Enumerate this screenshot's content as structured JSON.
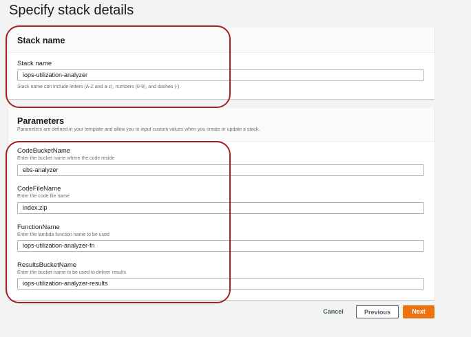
{
  "page_title": "Specify stack details",
  "stack": {
    "title": "Stack name",
    "label": "Stack name",
    "value": "iops-utilization-analyzer",
    "hint": "Stack name can include letters (A-Z and a-z), numbers (0-9), and dashes (-)."
  },
  "params": {
    "title": "Parameters",
    "description": "Parameters are defined in your template and allow you to input custom values when you create or update a stack.",
    "fields": [
      {
        "label": "CodeBucketName",
        "desc": "Enter the bucket name where the code reside",
        "value": "ebs-analyzer"
      },
      {
        "label": "CodeFileName",
        "desc": "Enter the code file name",
        "value": "index.zip"
      },
      {
        "label": "FunctionName",
        "desc": "Enter the lambda function name to be used",
        "value": "iops-utilization-analyzer-fn"
      },
      {
        "label": "ResultsBucketName",
        "desc": "Enter the bucket name to be used to deliver results",
        "value": "iops-utilization-analyzer-results"
      }
    ]
  },
  "buttons": {
    "cancel": "Cancel",
    "previous": "Previous",
    "next": "Next"
  },
  "colors": {
    "accent": "#ec7211",
    "highlight": "#a32121"
  }
}
